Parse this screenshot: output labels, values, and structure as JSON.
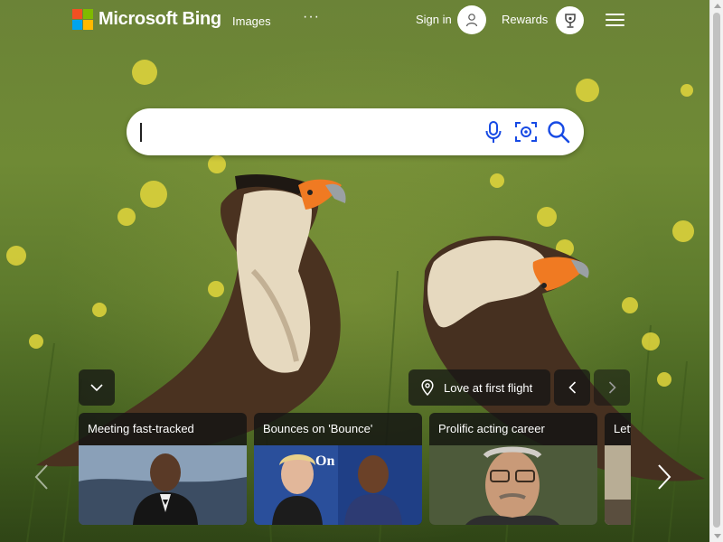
{
  "header": {
    "logo_text": "Microsoft Bing",
    "logo_colors": [
      "#f25022",
      "#7fba00",
      "#00a4ef",
      "#ffb900"
    ],
    "nav_images": "Images",
    "nav_more": "···",
    "signin": "Sign in",
    "rewards": "Rewards"
  },
  "search": {
    "value": "",
    "placeholder": "",
    "icons": [
      "microphone-icon",
      "visual-search-icon",
      "search-icon"
    ],
    "accent": "#174ae4"
  },
  "image_info": {
    "title": "Love at first flight",
    "icon": "location-pin-icon"
  },
  "cards": [
    {
      "title": "Meeting fast-tracked"
    },
    {
      "title": "Bounces on 'Bounce'"
    },
    {
      "title": "Prolific acting career"
    },
    {
      "title": "Lett"
    }
  ]
}
